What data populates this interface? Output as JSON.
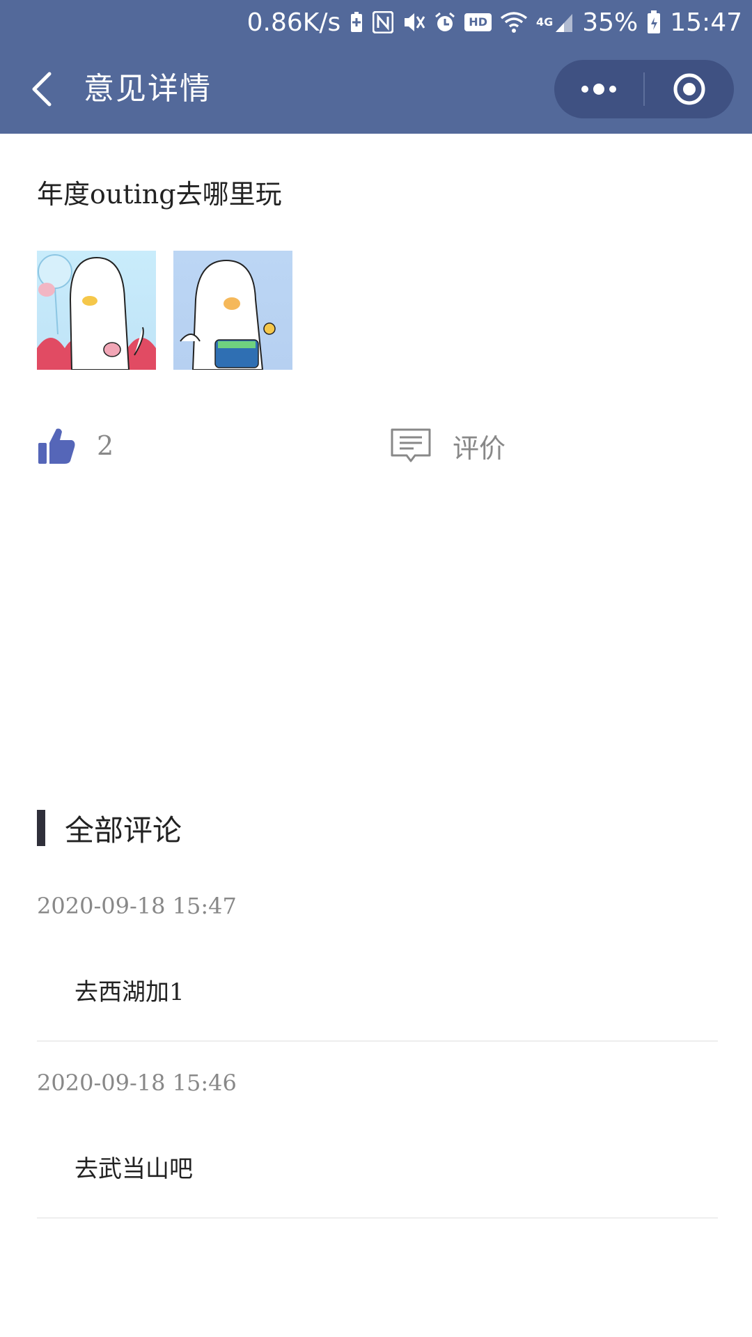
{
  "status_bar": {
    "net_speed": "0.86K/s",
    "signal_label": "4G",
    "hd_badge": "HD",
    "battery": "35%",
    "time": "15:47"
  },
  "nav": {
    "title": "意见详情"
  },
  "post": {
    "title": "年度outing去哪里玩",
    "like_count": "2",
    "comment_label": "评价"
  },
  "comments_section": {
    "title": "全部评论",
    "items": [
      {
        "time": "2020-09-18 15:47",
        "text": "去西湖加1"
      },
      {
        "time": "2020-09-18 15:46",
        "text": "去武当山吧"
      }
    ]
  },
  "colors": {
    "header": "#53699a",
    "capsule": "#3f5182",
    "like_icon": "#5566b8",
    "section_bar": "#2f2f3a"
  }
}
